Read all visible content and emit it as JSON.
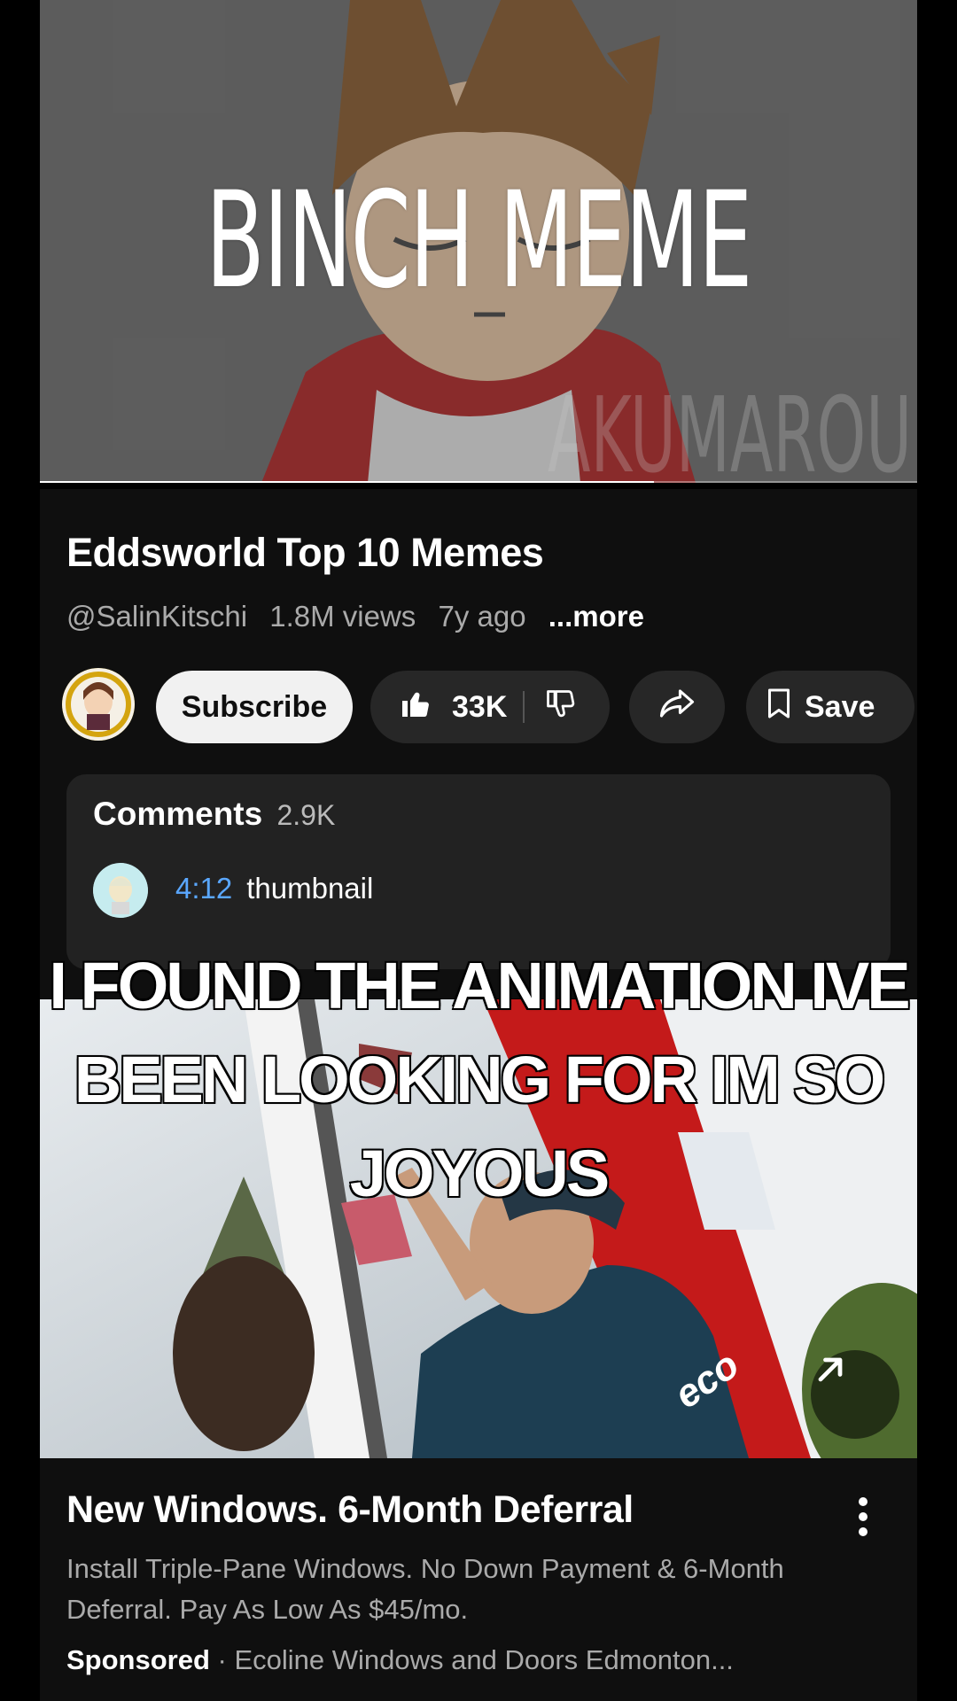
{
  "video": {
    "thumbnail_title": "BINCH MEME",
    "watermark": "AKUMAROU",
    "progress": 0.7
  },
  "info": {
    "title": "Eddsworld Top 10 Memes",
    "channel": "@SalinKitschi",
    "views": "1.8M views",
    "age": "7y ago",
    "more_label": "...more"
  },
  "actions": {
    "subscribe_label": "Subscribe",
    "likes": "33K",
    "save_label": "Save"
  },
  "comments": {
    "header": "Comments",
    "count": "2.9K",
    "top_comment": {
      "timestamp": "4:12",
      "text": "thumbnail"
    }
  },
  "overlay_caption": "I FOUND THE ANIMATION IVE BEEN LOOKING FOR IM SO JOYOUS",
  "ad": {
    "image_text": "eco",
    "title": "New Windows. 6-Month Deferral",
    "description": "Install Triple-Pane Windows. No Down Payment & 6-Month Deferral. Pay As Low As $45/mo.",
    "sponsored_label": "Sponsored",
    "separator": " · ",
    "advertiser": "Ecoline Windows and Doors Edmonton..."
  },
  "colors": {
    "background": "#000000",
    "panel": "#0f0f0f",
    "timestamp_link": "#5aa7ff"
  }
}
